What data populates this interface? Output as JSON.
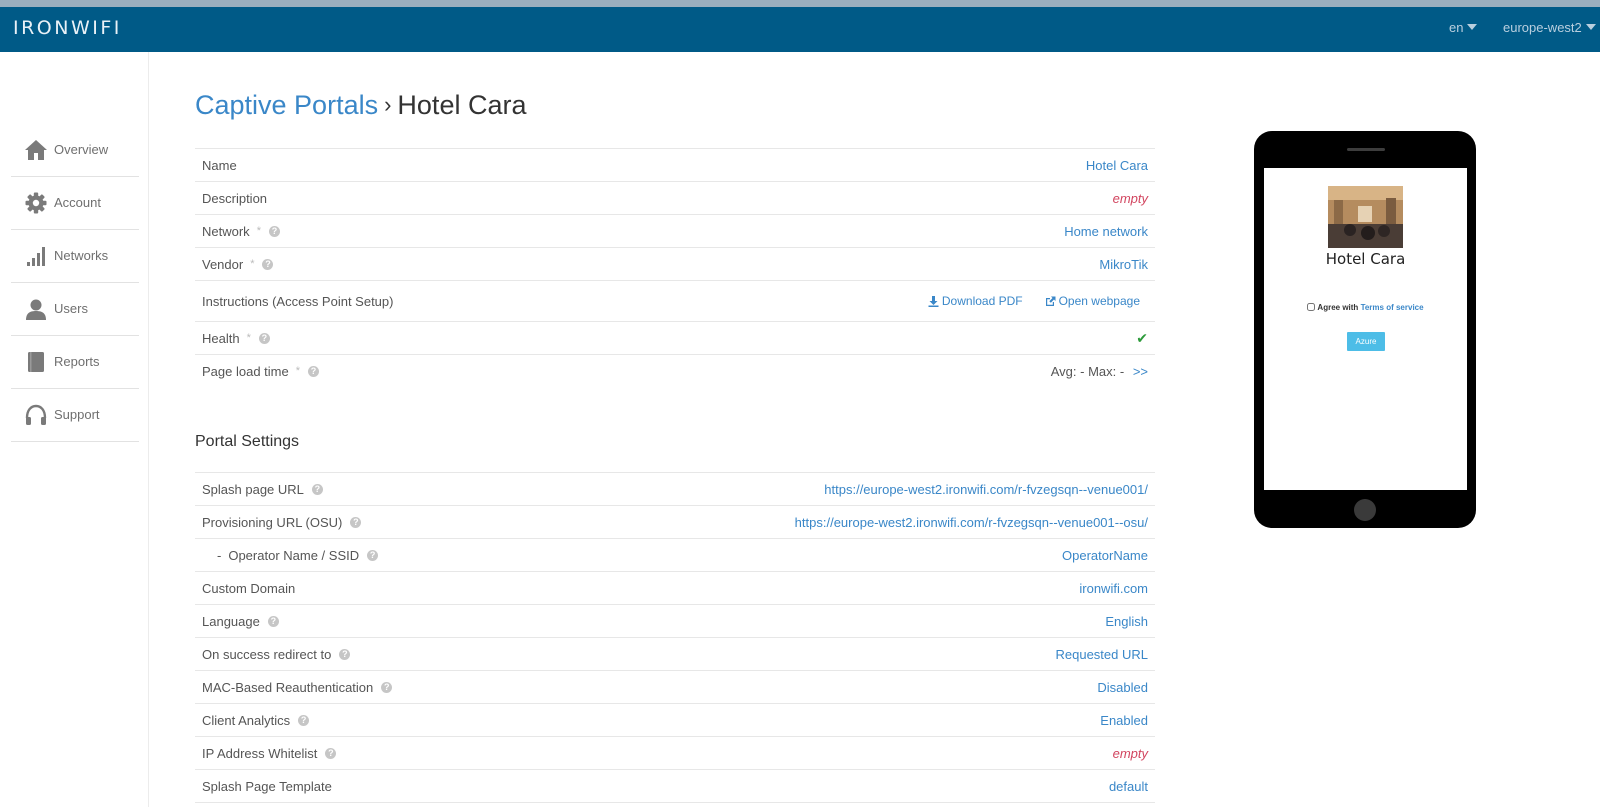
{
  "app": {
    "logo_text": "IRONWIFI",
    "language": "en",
    "region": "europe-west2"
  },
  "sidebar": {
    "items": [
      {
        "label": "Overview",
        "icon": "home-icon"
      },
      {
        "label": "Account",
        "icon": "gear-icon"
      },
      {
        "label": "Networks",
        "icon": "signal-bars-icon"
      },
      {
        "label": "Users",
        "icon": "user-icon"
      },
      {
        "label": "Reports",
        "icon": "book-icon"
      },
      {
        "label": "Support",
        "icon": "headset-icon"
      }
    ]
  },
  "breadcrumb": {
    "parent": "Captive Portals",
    "separator": "›",
    "current": "Hotel Cara"
  },
  "details": {
    "name_label": "Name",
    "name_value": "Hotel Cara",
    "description_label": "Description",
    "description_value": "empty",
    "network_label": "Network",
    "network_value": "Home network",
    "vendor_label": "Vendor",
    "vendor_value": "MikroTik",
    "instructions_label": "Instructions (Access Point Setup)",
    "download_pdf": "Download PDF",
    "open_webpage": "Open webpage",
    "health_label": "Health",
    "health_value": "✔",
    "page_load_label": "Page load time",
    "page_load_value": "Avg: - Max: -",
    "page_load_more": ">>",
    "required_mark": "*",
    "help_glyph": "?"
  },
  "portal_settings": {
    "title": "Portal Settings",
    "rows": [
      {
        "label": "Splash page URL",
        "value": "https://europe-west2.ironwifi.com/r-fvzegsqn--venue001/"
      },
      {
        "label": "Provisioning URL (OSU)",
        "value": "https://europe-west2.ironwifi.com/r-fvzegsqn--venue001--osu/"
      },
      {
        "prefix": "-",
        "label": "Operator Name / SSID",
        "value": "OperatorName"
      },
      {
        "label": "Custom Domain",
        "value": "ironwifi.com"
      },
      {
        "label": "Language",
        "value": "English"
      },
      {
        "label": "On success redirect to",
        "value": "Requested URL"
      },
      {
        "label": "MAC-Based Reauthentication",
        "value": "Disabled"
      },
      {
        "label": "Client Analytics",
        "value": "Enabled"
      },
      {
        "label": "IP Address Whitelist",
        "value": "empty"
      },
      {
        "label": "Splash Page Template",
        "value": "default"
      }
    ]
  },
  "preview": {
    "title": "Hotel Cara",
    "agree_text": "Agree with",
    "terms_link": "Terms of service",
    "button_label": "Azure"
  },
  "colors": {
    "topbar": "#005a87",
    "link": "#3a87c8",
    "empty": "#d2455f",
    "ok": "#2c9a3a"
  }
}
